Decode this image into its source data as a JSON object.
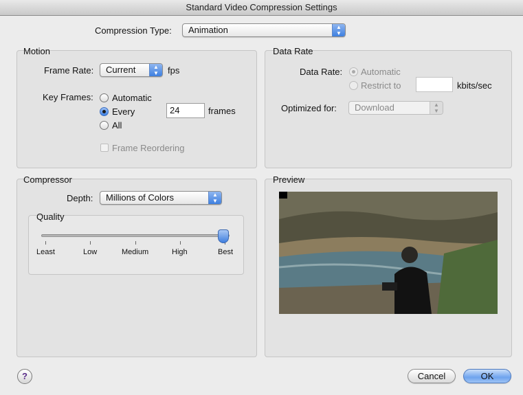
{
  "window": {
    "title": "Standard Video Compression Settings"
  },
  "compression_type": {
    "label": "Compression Type:",
    "value": "Animation"
  },
  "motion": {
    "title": "Motion",
    "frame_rate_label": "Frame Rate:",
    "frame_rate_value": "Current",
    "fps_label": "fps",
    "key_frames_label": "Key Frames:",
    "options": {
      "automatic": "Automatic",
      "every": "Every",
      "all": "All"
    },
    "selected": "every",
    "every_value": "24",
    "frames_label": "frames",
    "frame_reordering": "Frame Reordering"
  },
  "data_rate": {
    "title": "Data Rate",
    "data_rate_label": "Data Rate:",
    "automatic": "Automatic",
    "restrict_to": "Restrict to",
    "restrict_value": "",
    "unit": "kbits/sec",
    "optimized_label": "Optimized for:",
    "optimized_value": "Download"
  },
  "compressor": {
    "title": "Compressor",
    "depth_label": "Depth:",
    "depth_value": "Millions of Colors",
    "quality": {
      "title": "Quality",
      "levels": [
        "Least",
        "Low",
        "Medium",
        "High",
        "Best"
      ],
      "value": "Best"
    }
  },
  "preview": {
    "title": "Preview"
  },
  "buttons": {
    "help": "?",
    "cancel": "Cancel",
    "ok": "OK"
  },
  "colors": {
    "accent": "#3e7fe0",
    "help_glyph": "#5a2d8a"
  }
}
